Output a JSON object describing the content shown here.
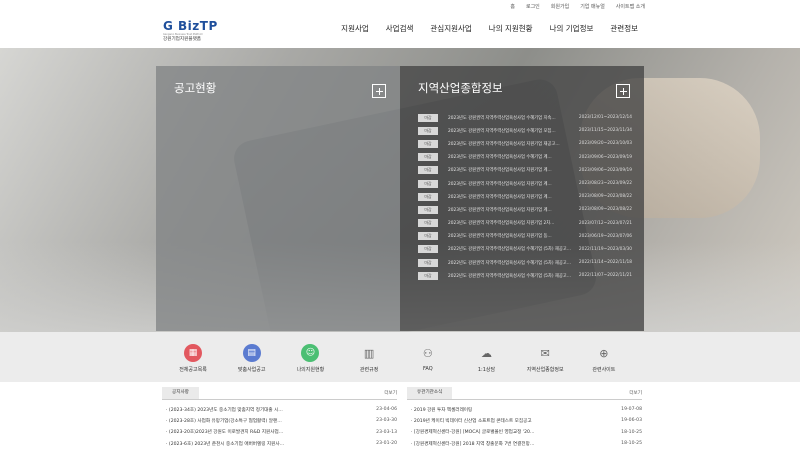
{
  "top_links": [
    "홈",
    "로그인",
    "회원가입",
    "기업 매뉴얼",
    "사이트맵 소개"
  ],
  "logo": {
    "main": "G BizTP",
    "tagline": "Gangwon Business Trust Platform",
    "sub": "강원기업지원플랫폼"
  },
  "nav": [
    "지원사업",
    "사업검색",
    "관심지원사업",
    "나의 지원현황",
    "나의 기업정보",
    "관련정보"
  ],
  "panels": {
    "left_title": "공고현황",
    "right_title": "지역산업종합정보"
  },
  "regional_notices": [
    {
      "badge": "마감",
      "title": "2023년도 강원권역 지역주력산업육성사업 수혜기업 지속…",
      "date": "2023/12/01~2023/12/14"
    },
    {
      "badge": "마감",
      "title": "2023년도 강원권역 지역주력산업육성사업 수혜기업 모집…",
      "date": "2023/11/15~2023/11/34"
    },
    {
      "badge": "마감",
      "title": "2023년도 강원권역 지역주력산업육성사업 지원기업 재공고…",
      "date": "2023/09/20~2023/10/03"
    },
    {
      "badge": "마감",
      "title": "2023년도 강원권역 지역주력산업육성사업 수혜기업 계…",
      "date": "2023/09/06~2023/09/19"
    },
    {
      "badge": "마감",
      "title": "2023년도 강원권역 지역주력산업육성사업 지원기업 계…",
      "date": "2023/09/06~2023/09/19"
    },
    {
      "badge": "마감",
      "title": "2023년도 강원권역 지역주력산업육성사업 지원기업 계…",
      "date": "2023/08/23~2023/09/22"
    },
    {
      "badge": "마감",
      "title": "2023년도 강원권역 지역주력산업육성사업 지원기업 계…",
      "date": "2023/08/09~2023/08/22"
    },
    {
      "badge": "마감",
      "title": "2023년도 강원권역 지역주력산업육성사업 지원기업 계…",
      "date": "2023/08/09~2023/08/22"
    },
    {
      "badge": "마감",
      "title": "2023년도 강원권역 지역주력산업육성사업 지원기업 2차…",
      "date": "2023/07/12~2023/07/21"
    },
    {
      "badge": "마감",
      "title": "2023년도 강원권역 지역주력산업육성사업 지원기업 동…",
      "date": "2023/06/19~2023/07/06"
    },
    {
      "badge": "마감",
      "title": "2022년도 강원권역 지역주력산업육성사업 수혜기업 (5차) 재공고…",
      "date": "2022/11/19~2023/03/30"
    },
    {
      "badge": "마감",
      "title": "2022년도 강원권역 지역주력산업육성사업 수혜기업 (5차) 재공고…",
      "date": "2022/11/14~2022/11/18"
    },
    {
      "badge": "마감",
      "title": "2022년도 강원권역 지역주력산업육성사업 수혜기업 (5차) 재공고…",
      "date": "2022/11/07~2022/11/21"
    }
  ],
  "quick_menu": [
    {
      "label": "전체공고목록",
      "icon": "calendar-icon",
      "color": "#e2585f",
      "glyph": "▦"
    },
    {
      "label": "맞춤사업공고",
      "icon": "document-check-icon",
      "color": "#5b7bd0",
      "glyph": "▤"
    },
    {
      "label": "나의지원현황",
      "icon": "person-chart-icon",
      "color": "#4bbf73",
      "glyph": "☺"
    },
    {
      "label": "관련규정",
      "icon": "book-icon",
      "color": "",
      "glyph": "▥"
    },
    {
      "label": "FAQ",
      "icon": "faq-icon",
      "color": "",
      "glyph": "⚇"
    },
    {
      "label": "1:1상담",
      "icon": "chat-icon",
      "color": "",
      "glyph": "☁"
    },
    {
      "label": "지역산업종합정보",
      "icon": "rips-icon",
      "color": "",
      "glyph": "✉"
    },
    {
      "label": "관련사이트",
      "icon": "globe-icon",
      "color": "",
      "glyph": "⊕"
    }
  ],
  "board_left": {
    "tab": "공지사항",
    "more": "더보기",
    "rows": [
      {
        "title": "(2023-34호) 2023년도 중소기업 맞춤지역 정기대출 시…",
        "date": "23-04-06"
      },
      {
        "title": "(2023-28호) 사업화 유망기업(강소특구 협업활력) 알랜…",
        "date": "23-03-30"
      },
      {
        "title": "(2023-20호)2023년 강원도 이로발견지 R&D 지원사업…",
        "date": "23-03-13"
      },
      {
        "title": "(2023-6호) 2023년 춘천시 중소기업 애버버렐링 지원사…",
        "date": "23-01-20"
      }
    ]
  },
  "board_right": {
    "tab": "유관기관소식",
    "more": "더보기",
    "rows": [
      {
        "title": "2019 강원 투자 엑셀러레이팅",
        "date": "19-07-08"
      },
      {
        "title": "2019년 케이티 빅데이터 신산업 소프트업 콘테스트 모집공고",
        "date": "19-06-03"
      },
      {
        "title": "[강원경제혁신센터-강원] [MOCA] 글로벌몰빈 영업교정 '20…",
        "date": "18-10-25"
      },
      {
        "title": "[강원경제혁신센터-강원] 2018 지역 창출문화 7번 연결전망…",
        "date": "18-10-25"
      }
    ]
  }
}
